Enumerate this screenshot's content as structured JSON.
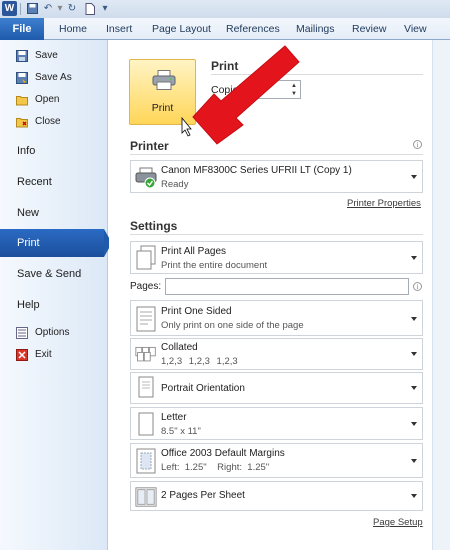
{
  "quick_access": {
    "app_icon": "word-icon",
    "app_letter": "W",
    "buttons": [
      "save-icon",
      "undo-icon",
      "redo-icon",
      "new-document-icon",
      "more-icon"
    ]
  },
  "ribbon": {
    "file_tab": "File",
    "tabs": [
      "Home",
      "Insert",
      "Page Layout",
      "References",
      "Mailings",
      "Review",
      "View"
    ]
  },
  "nav": {
    "commands_top": [
      {
        "label": "Save",
        "icon": "save-icon"
      },
      {
        "label": "Save As",
        "icon": "save-as-icon"
      },
      {
        "label": "Open",
        "icon": "open-folder-icon"
      },
      {
        "label": "Close",
        "icon": "close-folder-icon"
      }
    ],
    "tabs": [
      "Info",
      "Recent",
      "New",
      "Print",
      "Save & Send",
      "Help"
    ],
    "active_tab": "Print",
    "commands_bottom": [
      {
        "label": "Options",
        "icon": "options-icon"
      },
      {
        "label": "Exit",
        "icon": "exit-icon"
      }
    ]
  },
  "print": {
    "button_label": "Print",
    "title": "Print",
    "copies_label": "Copies:",
    "copies_value": "1"
  },
  "printer": {
    "heading": "Printer",
    "name": "Canon MF8300C Series UFRII LT (Copy 1)",
    "status": "Ready",
    "properties_link": "Printer Properties"
  },
  "settings": {
    "heading": "Settings",
    "pages_label": "Pages:",
    "pages_value": "",
    "items": [
      {
        "title": "Print All Pages",
        "subtitle": "Print the entire document",
        "icon": "pages-icon"
      },
      {
        "title": "Print One Sided",
        "subtitle": "Only print on one side of the page",
        "icon": "one-sided-icon"
      },
      {
        "title": "Collated",
        "subtitle": "1,2,3    1,2,3    1,2,3",
        "icon": "collated-icon"
      },
      {
        "title": "Portrait Orientation",
        "subtitle": "",
        "icon": "portrait-icon"
      },
      {
        "title": "Letter",
        "subtitle": "8.5\" x 11\"",
        "icon": "paper-size-icon"
      },
      {
        "title": "Office 2003 Default Margins",
        "subtitle": "Left:  1.25\"    Right:  1.25\"",
        "icon": "margins-icon"
      },
      {
        "title": "2 Pages Per Sheet",
        "subtitle": "",
        "icon": "pages-per-sheet-icon"
      }
    ],
    "page_setup_link": "Page Setup"
  },
  "colors": {
    "file_tab": "#1f5aab",
    "active_nav": "#2b6bc4",
    "print_button": "#ffd659",
    "annotation_arrow": "#e3141b"
  }
}
